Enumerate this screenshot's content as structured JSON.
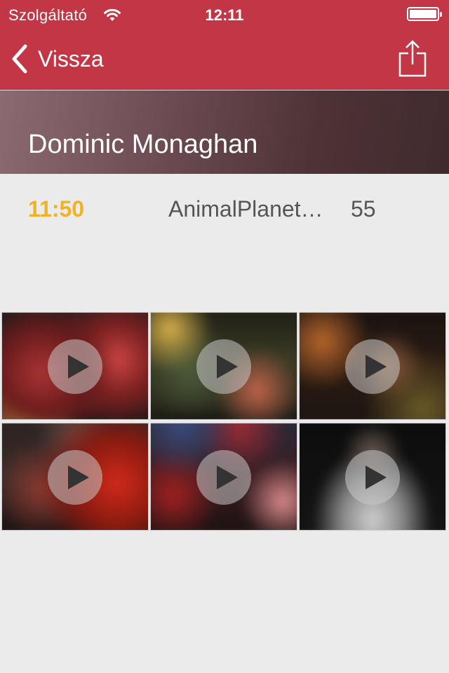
{
  "status": {
    "carrier": "Szolgáltató",
    "time": "12:11",
    "battery_level": 1.0
  },
  "nav": {
    "back_label": "Vissza",
    "share_icon": "share-icon"
  },
  "header": {
    "title": "Dominic Monaghan"
  },
  "broadcast": {
    "time": "11:50",
    "channel": "AnimalPlanet…",
    "number": "55"
  },
  "videos": [
    {
      "id": "video-1"
    },
    {
      "id": "video-2"
    },
    {
      "id": "video-3"
    },
    {
      "id": "video-4"
    },
    {
      "id": "video-5"
    },
    {
      "id": "video-6"
    }
  ],
  "colors": {
    "accent": "#c23645",
    "time_highlight": "#f0b323"
  }
}
